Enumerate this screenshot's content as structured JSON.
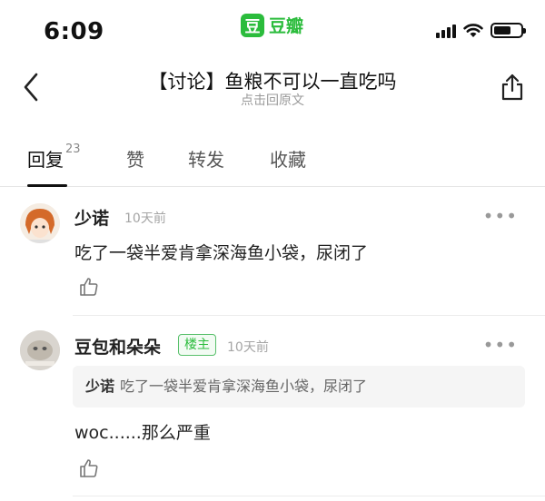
{
  "status_bar": {
    "time": "6:09",
    "app_logo": "豆",
    "app_name": "豆瓣"
  },
  "nav": {
    "title": "【讨论】鱼粮不可以一直吃吗",
    "subtitle": "点击回原文",
    "back_icon": "chevron-left-icon",
    "share_icon": "share-icon"
  },
  "tabs": [
    {
      "label": "回复",
      "count": "23",
      "active": true
    },
    {
      "label": "赞"
    },
    {
      "label": "转发"
    },
    {
      "label": "收藏"
    }
  ],
  "comments": [
    {
      "name": "少诺",
      "time": "10天前",
      "text": "吃了一袋半爱肯拿深海鱼小袋，尿闭了",
      "more": "•••"
    },
    {
      "name": "豆包和朵朵",
      "badge": "楼主",
      "time": "10天前",
      "more": "•••",
      "quote": {
        "author": "少诺",
        "text": "吃了一袋半爱肯拿深海鱼小袋，尿闭了"
      },
      "text": "woc......那么严重"
    }
  ],
  "colors": {
    "accent": "#2bbc3c",
    "text": "#222222",
    "muted": "#a5a5a5"
  }
}
